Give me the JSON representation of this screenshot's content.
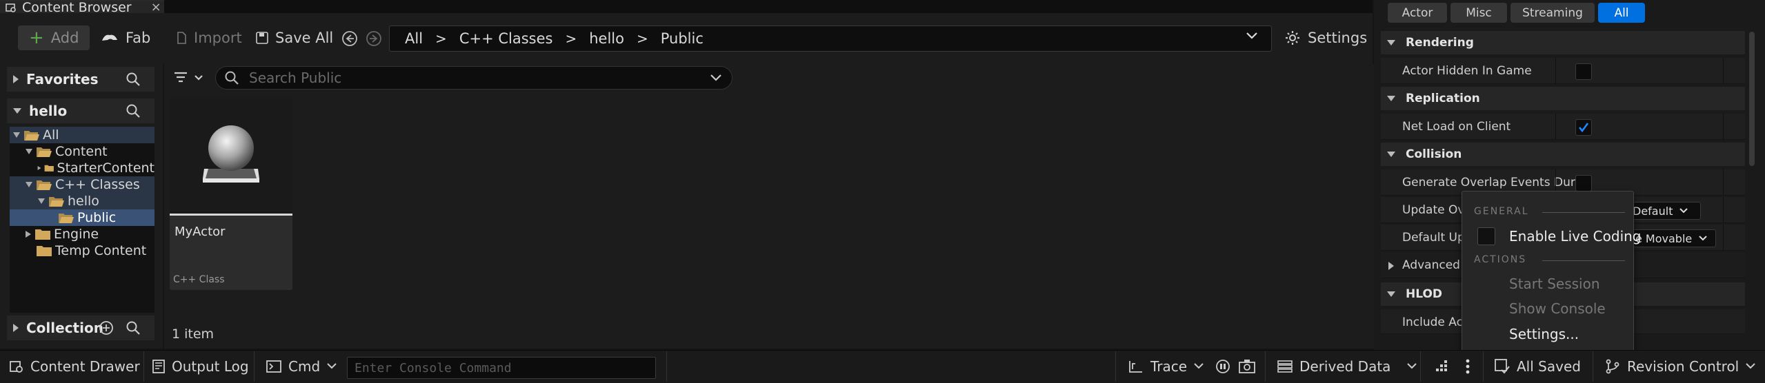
{
  "tab": {
    "title": "Content Browser",
    "close": "×"
  },
  "toolbar": {
    "add": "Add",
    "fab": "Fab",
    "import": "Import",
    "save_all": "Save All",
    "settings": "Settings",
    "path": [
      "All",
      "C++ Classes",
      "hello",
      "Public"
    ]
  },
  "sidebar": {
    "favorites": "Favorites",
    "project": "hello",
    "collections": "Collection",
    "tree": [
      "All",
      "Content",
      "StarterContent",
      "C++ Classes",
      "hello",
      "Public",
      "Engine",
      "Temp Content"
    ]
  },
  "search": {
    "placeholder": "Search Public"
  },
  "asset": {
    "name": "MyActor",
    "type": "C++ Class"
  },
  "item_count": "1 item",
  "details": {
    "filters": [
      "Actor",
      "Misc",
      "Streaming",
      "All"
    ],
    "active_filter": "All",
    "categories": {
      "rendering": "Rendering",
      "replication": "Replication",
      "collision": "Collision",
      "advanced": "Advanced",
      "hlod": "HLOD"
    },
    "props": {
      "actor_hidden": "Actor Hidden In Game",
      "net_load": "Net Load on Client",
      "gen_overlap": "Generate Overlap Events Duri...",
      "update_over": "Update Over",
      "default_upda": "Default Upda",
      "include_acto": "Include Acto"
    },
    "values": {
      "default_dropdown": "Default",
      "movable_dropdown": "e Movable"
    },
    "checkboxes": {
      "actor_hidden": false,
      "net_load": true,
      "gen_overlap": false
    }
  },
  "popup": {
    "general": "GENERAL",
    "live_coding": "Enable Live Coding",
    "actions": "ACTIONS",
    "start_session": "Start Session",
    "show_console": "Show Console",
    "settings": "Settings..."
  },
  "statusbar": {
    "content_drawer": "Content Drawer",
    "output_log": "Output Log",
    "cmd": "Cmd",
    "console_placeholder": "Enter Console Command",
    "trace": "Trace",
    "derived_data": "Derived Data",
    "all_saved": "All Saved",
    "revision_control": "Revision Control"
  },
  "colors": {
    "accent": "#0070e0",
    "folder": "#c9a25a",
    "add_plus": "#5fa84e"
  }
}
